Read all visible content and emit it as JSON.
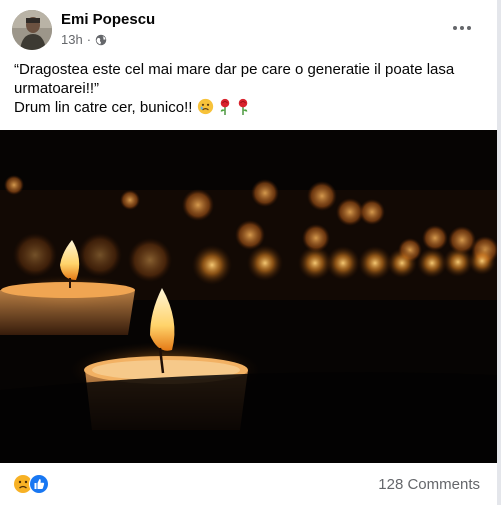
{
  "post": {
    "author": "Emi Popescu",
    "time": "13h",
    "separator": "·",
    "privacy_icon": "globe-icon",
    "caption_line1": "“Dragostea este cel mai mare dar pe care o generatie il poate lasa urmatoarei!!”",
    "caption_line2": "Drum lin catre cer, bunico!!",
    "caption_emojis": [
      "sad-face-emoji",
      "rose-emoji",
      "rose-emoji"
    ],
    "image_description_icon": "candles-photo"
  },
  "footer": {
    "reaction_icons": [
      "sad-reaction-icon",
      "like-reaction-icon"
    ],
    "comments_label": "128 Comments"
  },
  "colors": {
    "like_blue": "#1877f2",
    "reaction_yellow": "#f7b125",
    "text_secondary": "#65676b"
  }
}
